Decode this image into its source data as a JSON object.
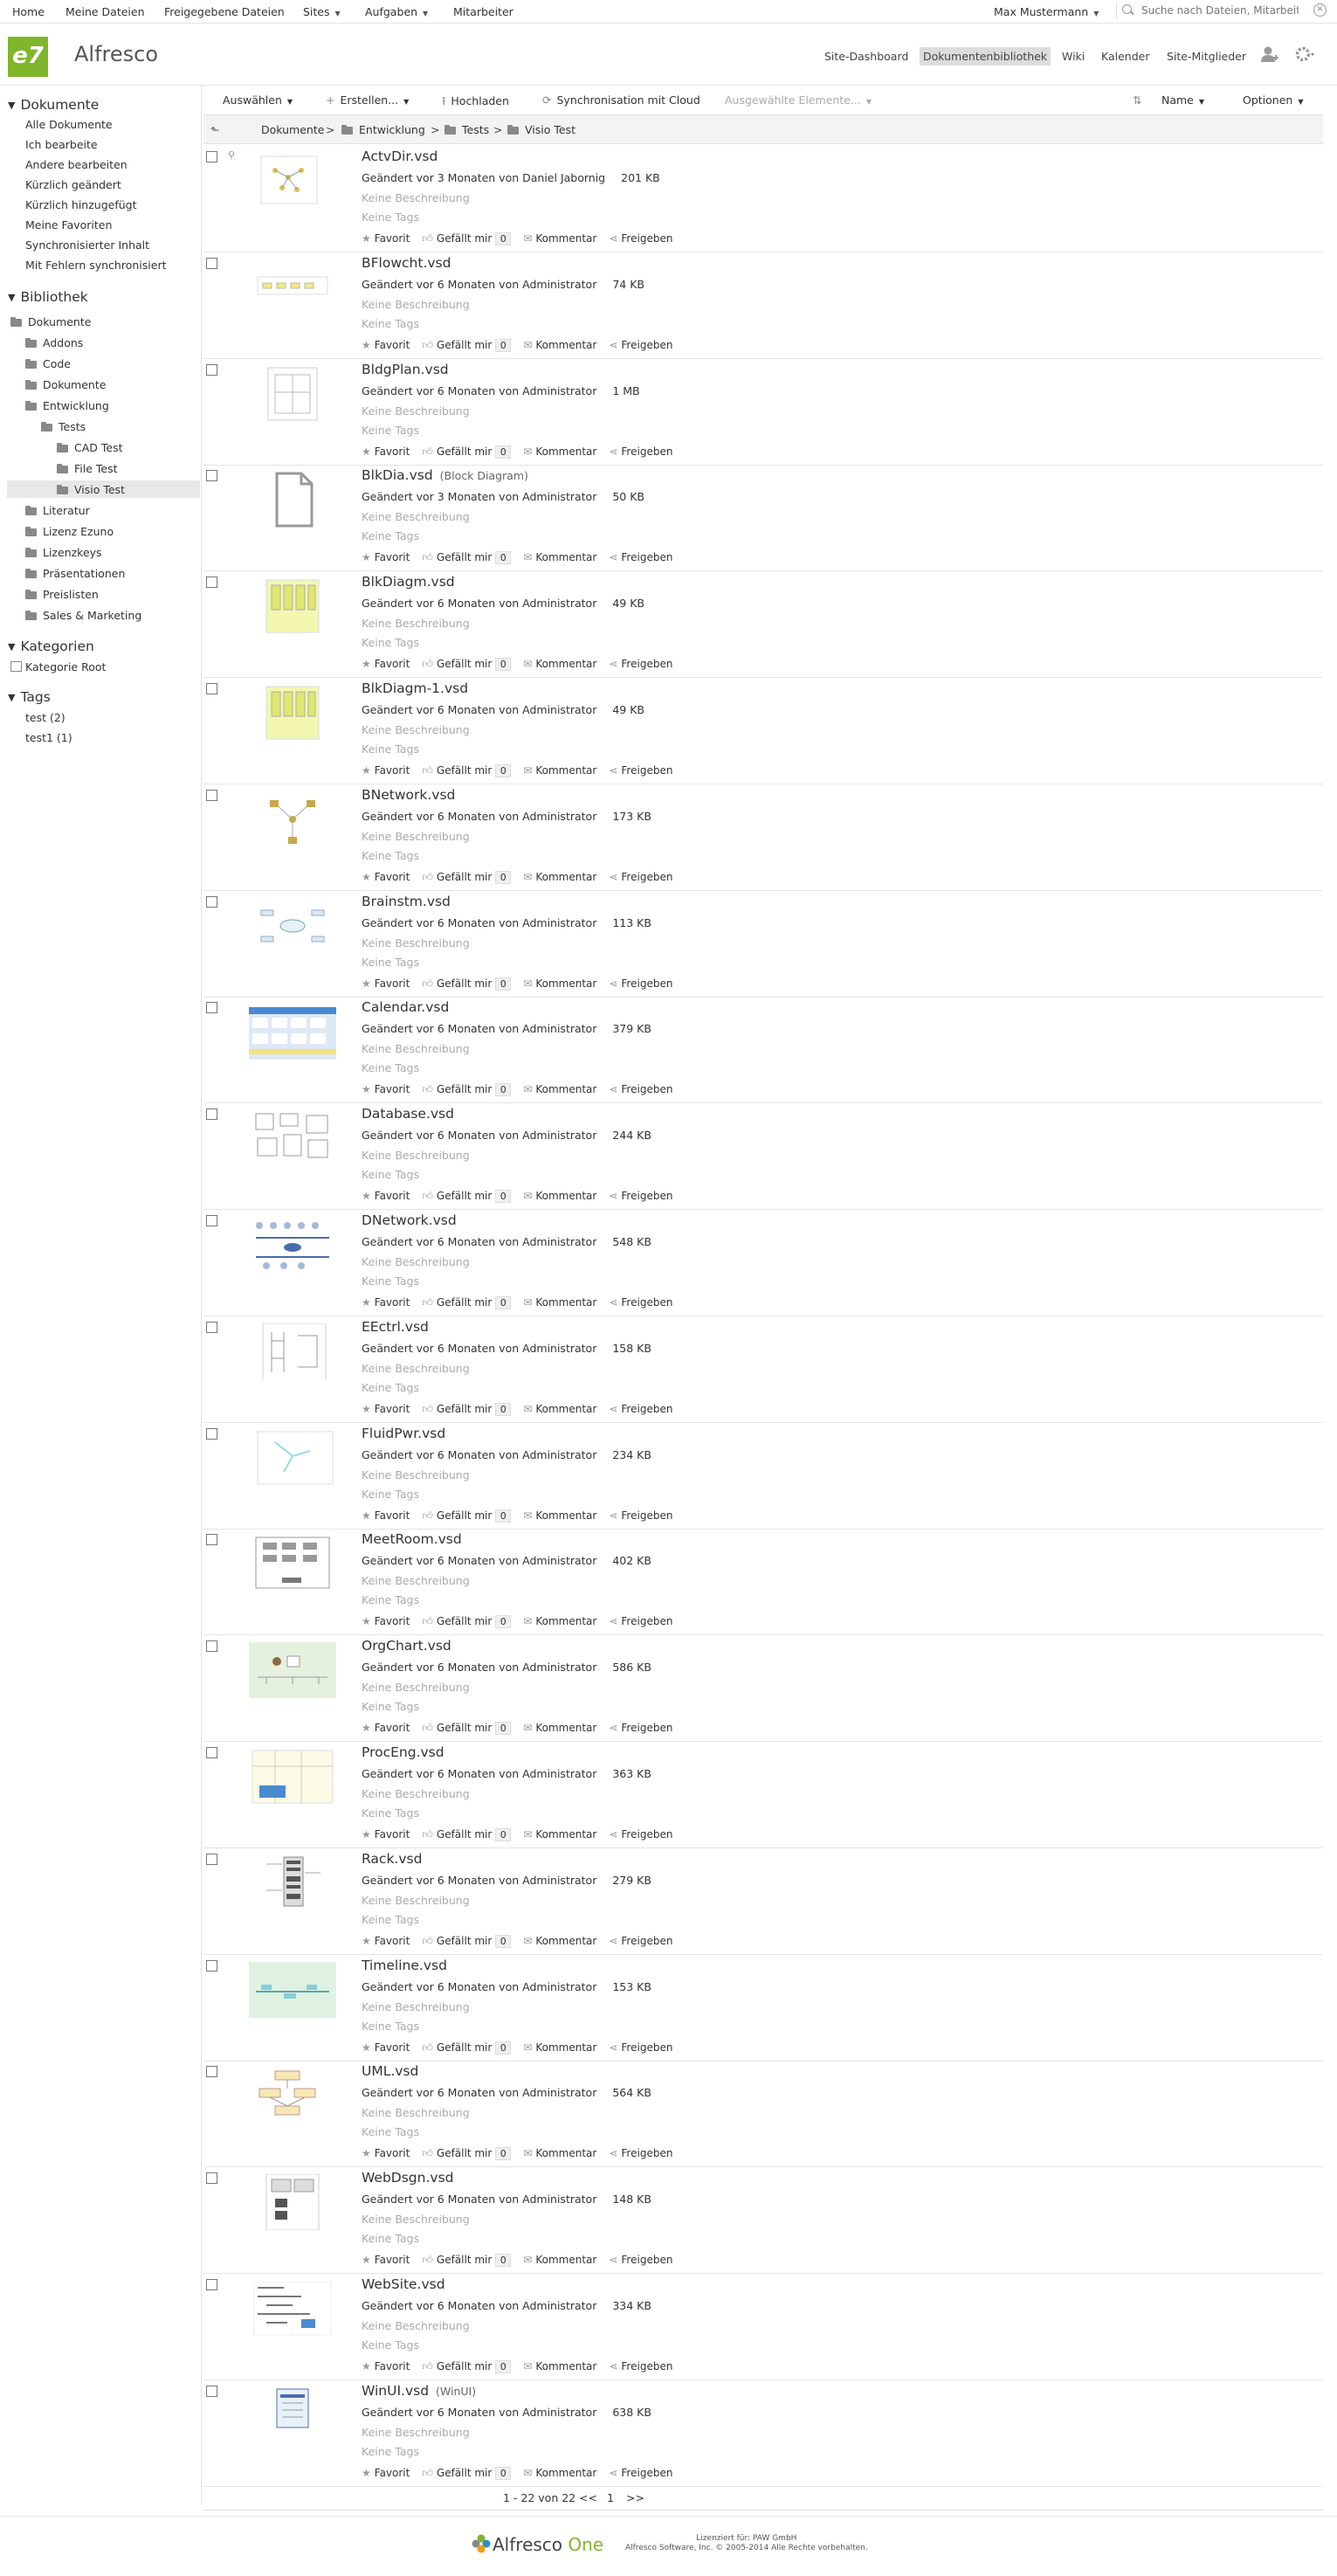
{
  "topnav": {
    "items": [
      "Home",
      "Meine Dateien",
      "Freigegebene Dateien",
      "Sites",
      "Aufgaben",
      "Mitarbeiter"
    ],
    "user": "Max Mustermann",
    "search_placeholder": "Suche nach Dateien, Mitarbeit"
  },
  "header": {
    "logo": "e7",
    "site_title": "Alfresco",
    "nav": [
      "Site-Dashboard",
      "Dokumentenbibliothek",
      "Wiki",
      "Kalender",
      "Site-Mitglieder"
    ]
  },
  "sidebar": {
    "documents_heading": "Dokumente",
    "documents": [
      "Alle Dokumente",
      "Ich bearbeite",
      "Andere bearbeiten",
      "Kürzlich geändert",
      "Kürzlich hinzugefügt",
      "Meine Favoriten",
      "Synchronisierter Inhalt",
      "Mit Fehlern synchronisiert"
    ],
    "library_heading": "Bibliothek",
    "tree": [
      "Dokumente",
      "Addons",
      "Code",
      "Dokumente",
      "Entwicklung",
      "Tests",
      "CAD Test",
      "File Test",
      "Visio Test",
      "Literatur",
      "Lizenz Ezuno",
      "Lizenzkeys",
      "Präsentationen",
      "Preislisten",
      "Sales & Marketing"
    ],
    "categories_heading": "Kategorien",
    "categories": [
      "Kategorie Root"
    ],
    "tags_heading": "Tags",
    "tags": [
      "test (2)",
      "test1 (1)"
    ]
  },
  "toolbar": {
    "select": "Auswählen",
    "create": "Erstellen...",
    "upload": "Hochladen",
    "sync": "Synchronisation mit Cloud",
    "selected": "Ausgewählte Elemente...",
    "sort": "Name",
    "options": "Optionen"
  },
  "breadcrumb": [
    "Dokumente",
    "Entwicklung",
    "Tests",
    "Visio Test"
  ],
  "labels": {
    "no_desc": "Keine Beschreibung",
    "no_tags": "Keine Tags",
    "favorite": "Favorit",
    "like": "Gefällt mir",
    "like_count": "0",
    "comment": "Kommentar",
    "share": "Freigeben"
  },
  "files": [
    {
      "name": "ActvDir.vsd",
      "sub": "",
      "meta": "Geändert vor 3 Monaten von Daniel Jabornig",
      "size": "201 KB"
    },
    {
      "name": "BFlowcht.vsd",
      "sub": "",
      "meta": "Geändert vor 6 Monaten von Administrator",
      "size": "74 KB"
    },
    {
      "name": "BldgPlan.vsd",
      "sub": "",
      "meta": "Geändert vor 6 Monaten von Administrator",
      "size": "1 MB"
    },
    {
      "name": "BlkDia.vsd",
      "sub": "(Block Diagram)",
      "meta": "Geändert vor 3 Monaten von Administrator",
      "size": "50 KB"
    },
    {
      "name": "BlkDiagm.vsd",
      "sub": "",
      "meta": "Geändert vor 6 Monaten von Administrator",
      "size": "49 KB"
    },
    {
      "name": "BlkDiagm-1.vsd",
      "sub": "",
      "meta": "Geändert vor 6 Monaten von Administrator",
      "size": "49 KB"
    },
    {
      "name": "BNetwork.vsd",
      "sub": "",
      "meta": "Geändert vor 6 Monaten von Administrator",
      "size": "173 KB"
    },
    {
      "name": "Brainstm.vsd",
      "sub": "",
      "meta": "Geändert vor 6 Monaten von Administrator",
      "size": "113 KB"
    },
    {
      "name": "Calendar.vsd",
      "sub": "",
      "meta": "Geändert vor 6 Monaten von Administrator",
      "size": "379 KB"
    },
    {
      "name": "Database.vsd",
      "sub": "",
      "meta": "Geändert vor 6 Monaten von Administrator",
      "size": "244 KB"
    },
    {
      "name": "DNetwork.vsd",
      "sub": "",
      "meta": "Geändert vor 6 Monaten von Administrator",
      "size": "548 KB"
    },
    {
      "name": "EEctrl.vsd",
      "sub": "",
      "meta": "Geändert vor 6 Monaten von Administrator",
      "size": "158 KB"
    },
    {
      "name": "FluidPwr.vsd",
      "sub": "",
      "meta": "Geändert vor 6 Monaten von Administrator",
      "size": "234 KB"
    },
    {
      "name": "MeetRoom.vsd",
      "sub": "",
      "meta": "Geändert vor 6 Monaten von Administrator",
      "size": "402 KB"
    },
    {
      "name": "OrgChart.vsd",
      "sub": "",
      "meta": "Geändert vor 6 Monaten von Administrator",
      "size": "586 KB"
    },
    {
      "name": "ProcEng.vsd",
      "sub": "",
      "meta": "Geändert vor 6 Monaten von Administrator",
      "size": "363 KB"
    },
    {
      "name": "Rack.vsd",
      "sub": "",
      "meta": "Geändert vor 6 Monaten von Administrator",
      "size": "279 KB"
    },
    {
      "name": "Timeline.vsd",
      "sub": "",
      "meta": "Geändert vor 6 Monaten von Administrator",
      "size": "153 KB"
    },
    {
      "name": "UML.vsd",
      "sub": "",
      "meta": "Geändert vor 6 Monaten von Administrator",
      "size": "564 KB"
    },
    {
      "name": "WebDsgn.vsd",
      "sub": "",
      "meta": "Geändert vor 6 Monaten von Administrator",
      "size": "148 KB"
    },
    {
      "name": "WebSite.vsd",
      "sub": "",
      "meta": "Geändert vor 6 Monaten von Administrator",
      "size": "334 KB"
    },
    {
      "name": "WinUI.vsd",
      "sub": "(WinUI)",
      "meta": "Geändert vor 6 Monaten von Administrator",
      "size": "638 KB"
    }
  ],
  "pager": {
    "range": "1 - 22 von 22",
    "prev": "<<",
    "page": "1",
    "next": ">>"
  },
  "footer": {
    "brand": "Alfresco",
    "brand_suffix": "One",
    "license_line1": "Lizenziert für: PAW GmbH",
    "license_line2": "Alfresco Software, Inc. © 2005-2014 Alle Rechte vorbehalten."
  },
  "colors": {
    "brand_green": "#7fb62c",
    "active_nav_bg": "#dcdcdc",
    "muted_text": "#aaaaaa"
  }
}
